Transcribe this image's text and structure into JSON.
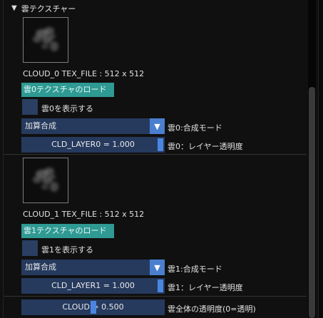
{
  "section": {
    "title": "雲テクスチャー",
    "icon": "triangle-down-icon"
  },
  "cloud0": {
    "tex_info": "CLOUD_0 TEX_FILE : 512 x 512",
    "load_button": "雲0テクスチャのロード",
    "show_label": "雲0を表示する",
    "blend_value": "加算合成",
    "blend_label": "雲0:合成モード",
    "layer_slider": "CLD_LAYER0 = 1.000",
    "layer_value": 1.0,
    "layer_label": "雲0：レイヤー透明度"
  },
  "cloud1": {
    "tex_info": "CLOUD_1 TEX_FILE : 512 x 512",
    "load_button": "雲1テクスチャのロード",
    "show_label": "雲1を表示する",
    "blend_value": "加算合成",
    "blend_label": "雲1:合成モード",
    "layer_slider": "CLD_LAYER1 = 1.000",
    "layer_value": 1.0,
    "layer_label": "雲1：レイヤー透明度"
  },
  "global": {
    "cloud_slider": "CLOUD = 0.500",
    "cloud_value": 0.5,
    "cloud_label": "雲全体の透明度(0=透明)"
  },
  "colors": {
    "button": "#2e9a93",
    "frame": "#263a5e",
    "accent": "#4a86e0"
  }
}
